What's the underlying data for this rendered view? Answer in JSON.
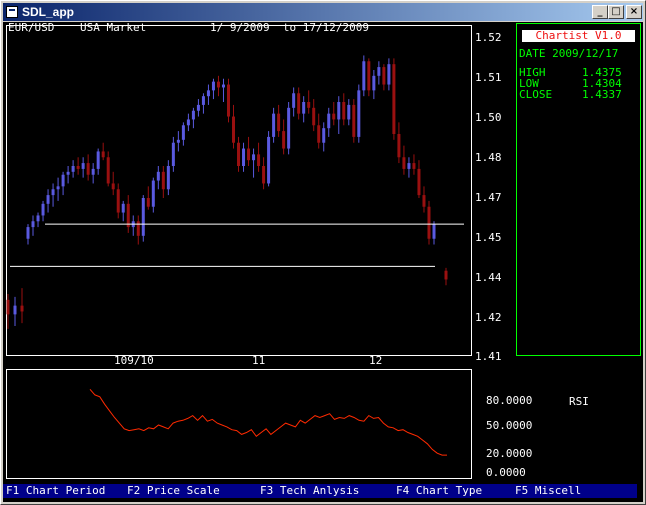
{
  "window": {
    "title": "SDL_app",
    "min": "_",
    "max": "□",
    "close": "×"
  },
  "chart": {
    "header": {
      "pair": "EUR/USD",
      "market": "USA Market",
      "date_range": "1/ 9/2009  to 17/12/2009"
    },
    "price_ticks": [
      "1.52",
      "1.51",
      "1.50",
      "1.48",
      "1.47",
      "1.45",
      "1.44",
      "1.42",
      "1.41"
    ],
    "x_ticks": [
      "109/10",
      "11",
      "12"
    ]
  },
  "rsi": {
    "label": "RSI",
    "ticks": [
      "80.0000",
      "50.0000",
      "20.0000",
      "0.0000"
    ]
  },
  "sidebar": {
    "logo": "Chartist V1.0",
    "date": "DATE 2009/12/17",
    "high_label": "HIGH",
    "high_value": "1.4375",
    "low_label": "LOW",
    "low_value": "1.4304",
    "close_label": "CLOSE",
    "close_value": "1.4337"
  },
  "menu": {
    "f1": "F1 Chart Period",
    "f2": "F2 Price Scale",
    "f3": "F3 Tech Anlysis",
    "f4": "F4 Chart Type",
    "f5": "F5 Miscell"
  },
  "colors": {
    "up_candle": "#5a5ae0",
    "down_candle": "#9a1010",
    "rsi_line": "#ff2a00",
    "sidebar_border": "#00ff00",
    "menu_bg": "#00008a"
  },
  "chart_data": {
    "type": "candlestick",
    "ohlc": [
      [
        1.43,
        1.432,
        1.42,
        1.425
      ],
      [
        1.425,
        1.431,
        1.421,
        1.428
      ],
      [
        1.428,
        1.434,
        1.422,
        1.426
      ],
      [
        1.451,
        1.456,
        1.449,
        1.455
      ],
      [
        1.455,
        1.459,
        1.452,
        1.457
      ],
      [
        1.457,
        1.46,
        1.455,
        1.459
      ],
      [
        1.459,
        1.464,
        1.457,
        1.463
      ],
      [
        1.463,
        1.468,
        1.46,
        1.466
      ],
      [
        1.466,
        1.47,
        1.462,
        1.468
      ],
      [
        1.468,
        1.472,
        1.464,
        1.469
      ],
      [
        1.469,
        1.474,
        1.466,
        1.473
      ],
      [
        1.473,
        1.476,
        1.47,
        1.474
      ],
      [
        1.474,
        1.478,
        1.472,
        1.476
      ],
      [
        1.476,
        1.479,
        1.473,
        1.475
      ],
      [
        1.475,
        1.479,
        1.472,
        1.477
      ],
      [
        1.477,
        1.48,
        1.471,
        1.473
      ],
      [
        1.473,
        1.477,
        1.47,
        1.475
      ],
      [
        1.475,
        1.482,
        1.473,
        1.481
      ],
      [
        1.481,
        1.484,
        1.478,
        1.479
      ],
      [
        1.479,
        1.481,
        1.469,
        1.47
      ],
      [
        1.47,
        1.474,
        1.466,
        1.468
      ],
      [
        1.468,
        1.47,
        1.458,
        1.46
      ],
      [
        1.46,
        1.464,
        1.457,
        1.463
      ],
      [
        1.463,
        1.466,
        1.453,
        1.455
      ],
      [
        1.455,
        1.459,
        1.452,
        1.457
      ],
      [
        1.457,
        1.459,
        1.449,
        1.452
      ],
      [
        1.452,
        1.466,
        1.45,
        1.465
      ],
      [
        1.465,
        1.469,
        1.461,
        1.462
      ],
      [
        1.462,
        1.472,
        1.46,
        1.471
      ],
      [
        1.471,
        1.476,
        1.468,
        1.474
      ],
      [
        1.474,
        1.476,
        1.465,
        1.468
      ],
      [
        1.468,
        1.478,
        1.466,
        1.476
      ],
      [
        1.476,
        1.486,
        1.474,
        1.484
      ],
      [
        1.484,
        1.488,
        1.481,
        1.485
      ],
      [
        1.485,
        1.491,
        1.483,
        1.49
      ],
      [
        1.49,
        1.494,
        1.488,
        1.492
      ],
      [
        1.492,
        1.496,
        1.489,
        1.495
      ],
      [
        1.495,
        1.499,
        1.493,
        1.497
      ],
      [
        1.497,
        1.501,
        1.494,
        1.5
      ],
      [
        1.5,
        1.504,
        1.497,
        1.502
      ],
      [
        1.502,
        1.506,
        1.499,
        1.505
      ],
      [
        1.505,
        1.507,
        1.5,
        1.503
      ],
      [
        1.503,
        1.506,
        1.498,
        1.504
      ],
      [
        1.504,
        1.506,
        1.491,
        1.493
      ],
      [
        1.493,
        1.497,
        1.482,
        1.484
      ],
      [
        1.484,
        1.486,
        1.474,
        1.476
      ],
      [
        1.476,
        1.484,
        1.474,
        1.482
      ],
      [
        1.482,
        1.486,
        1.476,
        1.478
      ],
      [
        1.478,
        1.482,
        1.472,
        1.48
      ],
      [
        1.48,
        1.484,
        1.474,
        1.476
      ],
      [
        1.476,
        1.479,
        1.468,
        1.47
      ],
      [
        1.47,
        1.488,
        1.469,
        1.486
      ],
      [
        1.486,
        1.496,
        1.484,
        1.494
      ],
      [
        1.494,
        1.497,
        1.486,
        1.488
      ],
      [
        1.488,
        1.492,
        1.48,
        1.482
      ],
      [
        1.482,
        1.498,
        1.48,
        1.496
      ],
      [
        1.496,
        1.503,
        1.493,
        1.501
      ],
      [
        1.501,
        1.503,
        1.492,
        1.494
      ],
      [
        1.494,
        1.5,
        1.491,
        1.498
      ],
      [
        1.498,
        1.502,
        1.494,
        1.496
      ],
      [
        1.496,
        1.499,
        1.488,
        1.49
      ],
      [
        1.49,
        1.494,
        1.482,
        1.484
      ],
      [
        1.484,
        1.491,
        1.481,
        1.489
      ],
      [
        1.489,
        1.496,
        1.486,
        1.494
      ],
      [
        1.494,
        1.498,
        1.49,
        1.492
      ],
      [
        1.492,
        1.5,
        1.487,
        1.498
      ],
      [
        1.498,
        1.501,
        1.49,
        1.492
      ],
      [
        1.492,
        1.499,
        1.49,
        1.497
      ],
      [
        1.497,
        1.499,
        1.484,
        1.486
      ],
      [
        1.486,
        1.504,
        1.484,
        1.502
      ],
      [
        1.502,
        1.514,
        1.5,
        1.512
      ],
      [
        1.512,
        1.513,
        1.5,
        1.502
      ],
      [
        1.502,
        1.509,
        1.499,
        1.507
      ],
      [
        1.507,
        1.512,
        1.504,
        1.51
      ],
      [
        1.51,
        1.511,
        1.502,
        1.504
      ],
      [
        1.504,
        1.513,
        1.502,
        1.511
      ],
      [
        1.511,
        1.513,
        1.485,
        1.487
      ],
      [
        1.487,
        1.491,
        1.477,
        1.479
      ],
      [
        1.479,
        1.483,
        1.473,
        1.475
      ],
      [
        1.475,
        1.479,
        1.472,
        1.477
      ],
      [
        1.477,
        1.48,
        1.473,
        1.475
      ],
      [
        1.475,
        1.478,
        1.465,
        1.466
      ],
      [
        1.466,
        1.469,
        1.46,
        1.462
      ],
      [
        1.462,
        1.464,
        1.449,
        1.451
      ],
      [
        1.451,
        1.457,
        1.449,
        1.456
      ],
      [
        1.44,
        1.441,
        1.435,
        1.437
      ]
    ],
    "support_lines": [
      1.456,
      1.4415
    ],
    "ylim": [
      1.41,
      1.52
    ],
    "rsi": [
      88,
      82,
      80,
      72,
      65,
      58,
      52,
      46,
      44,
      45,
      46,
      44,
      47,
      46,
      50,
      48,
      46,
      52,
      54,
      55,
      57,
      60,
      55,
      60,
      54,
      56,
      52,
      50,
      48,
      45,
      44,
      40,
      42,
      45,
      38,
      42,
      46,
      40,
      44,
      48,
      52,
      50,
      48,
      55,
      52,
      56,
      60,
      58,
      60,
      62,
      56,
      58,
      57,
      60,
      58,
      55,
      54,
      60,
      57,
      58,
      52,
      48,
      47,
      44,
      45,
      42,
      40,
      38,
      34,
      30,
      24,
      20,
      18,
      18
    ],
    "rsi_ylim": [
      0,
      100
    ]
  }
}
